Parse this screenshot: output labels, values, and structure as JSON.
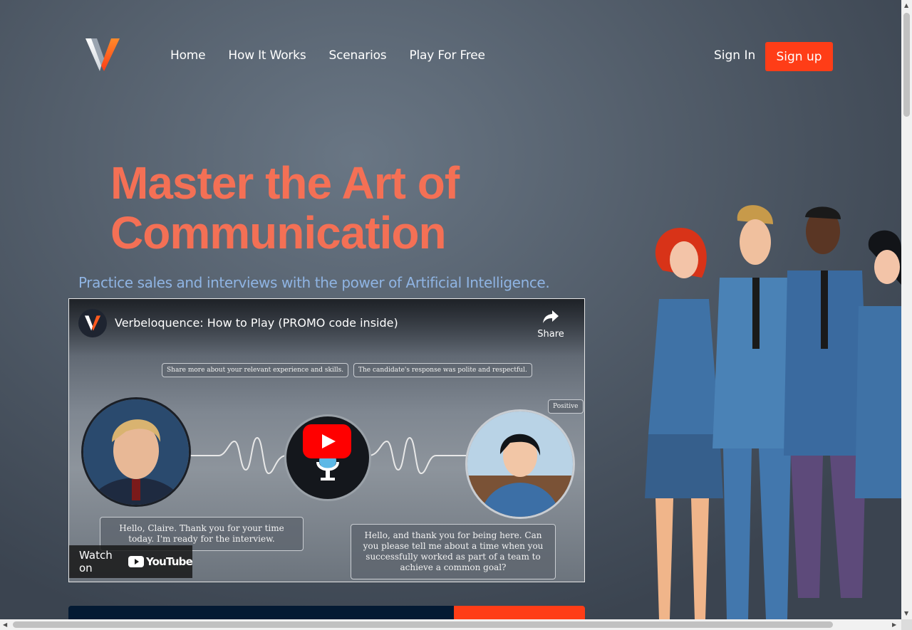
{
  "nav": {
    "items": [
      "Home",
      "How It Works",
      "Scenarios",
      "Play For Free"
    ],
    "sign_in": "Sign In",
    "sign_up": "Sign up"
  },
  "hero": {
    "title_line1": "Master the Art of",
    "title_line2": "Communication",
    "subtitle": "Practice sales and interviews with the power of Artificial Intelligence."
  },
  "video": {
    "title": "Verbeloquence: How to Play (PROMO code inside)",
    "share_label": "Share",
    "watch_on": "Watch on",
    "youtube": "YouTube",
    "bubble_top_left": "Share more about your relevant experience and skills.",
    "bubble_top_right": "The candidate's response was polite and respectful.",
    "badge": "Positive",
    "bubble_bottom_left": "Hello, Claire. Thank you for your time today. I'm ready for the interview.",
    "bubble_bottom_right": "Hello, and thank you for being here. Can you please tell me about a time when you successfully worked as part of a team to achieve a common goal?"
  },
  "colors": {
    "accent": "#ff3d17",
    "title": "#f47055",
    "subtitle": "#8fb4e3",
    "cta_dark": "#041a33"
  }
}
